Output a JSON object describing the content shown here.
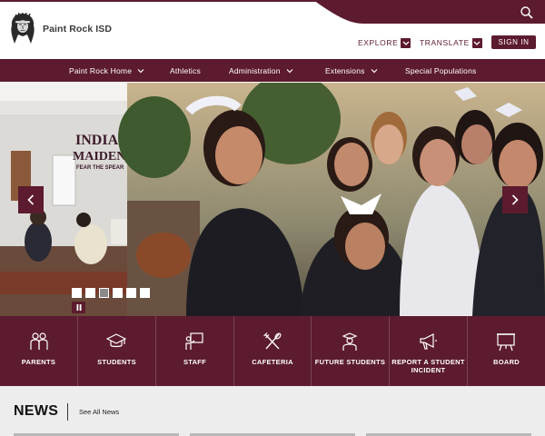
{
  "site": {
    "name": "Paint Rock ISD"
  },
  "header": {
    "explore_label": "EXPLORE",
    "translate_label": "TRANSLATE",
    "signin_label": "SIGN IN"
  },
  "nav": {
    "items": [
      {
        "label": "Paint Rock Home",
        "has_dropdown": true
      },
      {
        "label": "Athletics",
        "has_dropdown": false
      },
      {
        "label": "Administration",
        "has_dropdown": true
      },
      {
        "label": "Extensions",
        "has_dropdown": true
      },
      {
        "label": "Special Populations",
        "has_dropdown": false
      }
    ]
  },
  "hero": {
    "slide_count": 6,
    "active_slide": 3,
    "sign_line1": "INDIANS",
    "sign_line2": "MAIDENS",
    "sign_line3": "FEAR THE SPEAR"
  },
  "quick_links": [
    {
      "label": "PARENTS",
      "icon": "parents-icon"
    },
    {
      "label": "STUDENTS",
      "icon": "graduation-cap-icon"
    },
    {
      "label": "STAFF",
      "icon": "staff-presentation-icon"
    },
    {
      "label": "CAFETERIA",
      "icon": "utensils-icon"
    },
    {
      "label": "FUTURE STUDENTS",
      "icon": "future-student-icon"
    },
    {
      "label": "REPORT A STUDENT",
      "label2": "INCIDENT",
      "icon": "megaphone-icon"
    },
    {
      "label": "BOARD",
      "icon": "board-icon"
    }
  ],
  "news": {
    "title": "NEWS",
    "see_all": "See All News"
  },
  "colors": {
    "brand": "#5c1b2e",
    "white": "#ffffff",
    "news_bg": "#ededed"
  }
}
